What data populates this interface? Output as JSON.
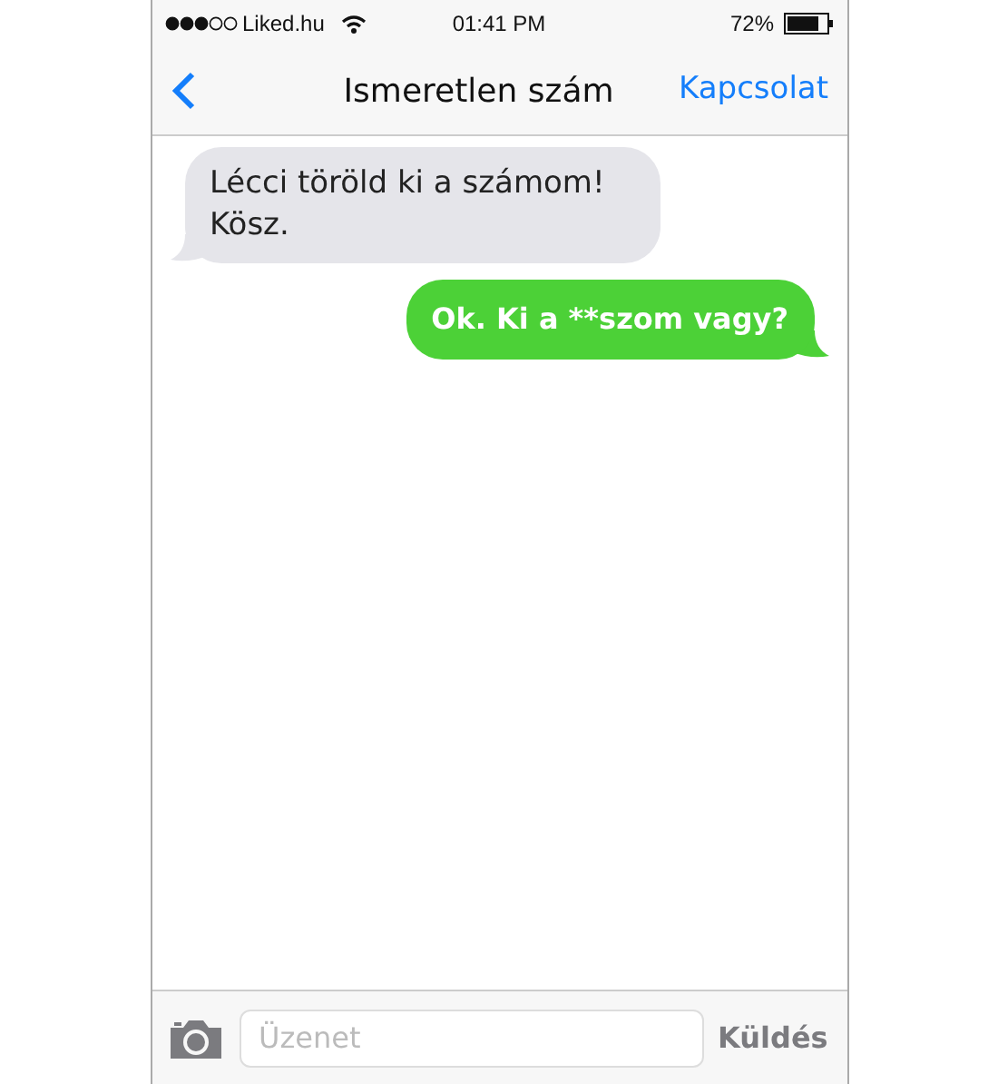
{
  "status_bar": {
    "carrier": "Liked.hu",
    "time": "01:41 PM",
    "battery": "72%"
  },
  "nav": {
    "title": "Ismeretlen szám",
    "action": "Kapcsolat"
  },
  "messages": [
    {
      "kind": "incoming",
      "text": "Lécci töröld ki a számom! Kösz."
    },
    {
      "kind": "outgoing",
      "text": "Ok. Ki a **szom vagy?"
    }
  ],
  "composer": {
    "placeholder": "Üzenet",
    "send": "Küldés"
  }
}
